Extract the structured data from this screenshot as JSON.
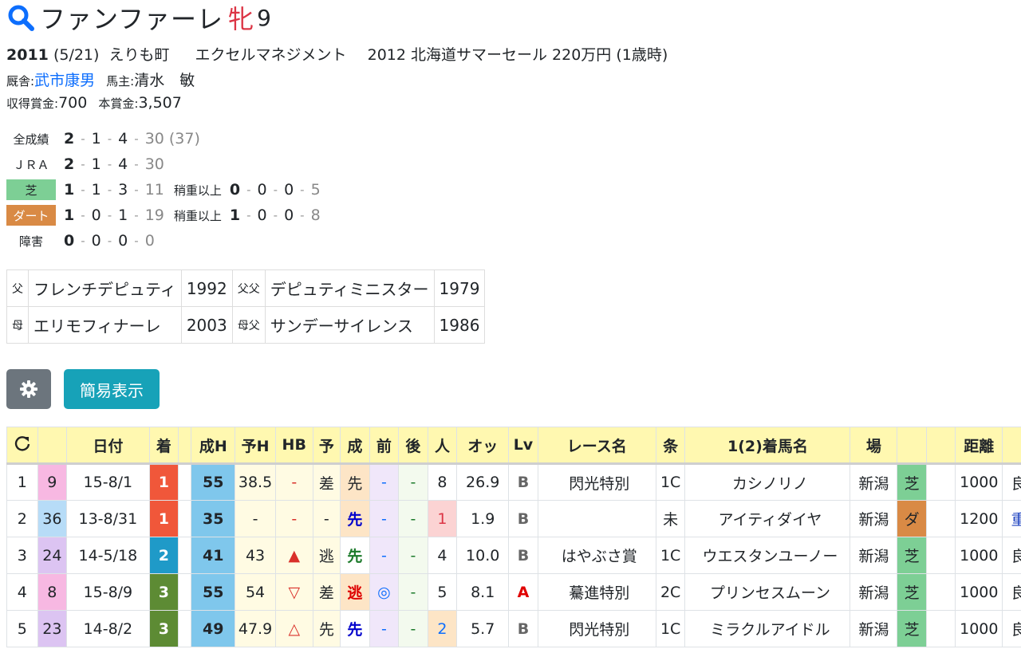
{
  "horse": {
    "name": "ファンファーレ",
    "sex": "牝",
    "age": "9"
  },
  "profile": {
    "birth_year": "2011",
    "birth_date": "(5/21)",
    "breeder_place": "えりも町",
    "breeder": "エクセルマネジメント",
    "sale": "2012 北海道サマーセール 220万円 (1歳時)",
    "trainer_label": "厩舎:",
    "trainer": "武市康男",
    "owner_label": "馬主:",
    "owner": "清水　敏",
    "earned_label": "収得賞金:",
    "earned": "700",
    "prize_label": "本賞金:",
    "prize": "3,507"
  },
  "record": {
    "all": {
      "label": "全成績",
      "w": "2",
      "s": "1",
      "t": "4",
      "o": "30",
      "extra": "(37)"
    },
    "jra": {
      "label": "ＪＲＡ",
      "w": "2",
      "s": "1",
      "t": "4",
      "o": "30"
    },
    "turf": {
      "label": "芝",
      "w": "1",
      "s": "1",
      "t": "3",
      "o": "11",
      "sub_label": "稍重以上",
      "sw": "0",
      "ss": "0",
      "st": "0",
      "so": "5"
    },
    "dirt": {
      "label": "ダート",
      "w": "1",
      "s": "0",
      "t": "1",
      "o": "19",
      "sub_label": "稍重以上",
      "sw": "1",
      "ss": "0",
      "st": "0",
      "so": "8"
    },
    "jump": {
      "label": "障害",
      "w": "0",
      "s": "0",
      "t": "0",
      "o": "0"
    }
  },
  "pedigree": {
    "sire_label": "父",
    "sire": "フレンチデピュティ",
    "sire_year": "1992",
    "sire_sire_label": "父父",
    "sire_sire": "デピュティミニスター",
    "sire_sire_year": "1979",
    "dam_label": "母",
    "dam": "エリモフィナーレ",
    "dam_year": "2003",
    "dam_sire_label": "母父",
    "dam_sire": "サンデーサイレンス",
    "dam_sire_year": "1986"
  },
  "buttons": {
    "simple_view": "簡易表示"
  },
  "table": {
    "headers": [
      "",
      "",
      "日付",
      "着",
      "",
      "成H",
      "予H",
      "HB",
      "予",
      "成",
      "前",
      "後",
      "人",
      "オッ",
      "Lv",
      "レース名",
      "条",
      "1(2)着馬名",
      "場",
      "",
      "",
      "距離",
      ""
    ],
    "rows": [
      {
        "no": "1",
        "waku": "9",
        "date": "15-8/1",
        "rank": "1",
        "seih": "55",
        "yoh": "38.5",
        "hb": "-",
        "yo": "差",
        "sei": "先",
        "mae": "-",
        "ato": "-",
        "pop": "8",
        "odds": "26.9",
        "lv": "B",
        "race": "閃光特別",
        "cond": "1C",
        "winner": "カシノリノ",
        "track": "新潟",
        "surface": "芝",
        "dist": "1000",
        "going": "良"
      },
      {
        "no": "2",
        "waku": "36",
        "date": "13-8/31",
        "rank": "1",
        "seih": "35",
        "yoh": "-",
        "hb": "-",
        "yo": "-",
        "sei": "先",
        "mae": "-",
        "ato": "-",
        "pop": "1",
        "odds": "1.9",
        "lv": "B",
        "race": "",
        "cond": "未",
        "winner": "アイティダイヤ",
        "track": "新潟",
        "surface": "ダ",
        "dist": "1200",
        "going": "重"
      },
      {
        "no": "3",
        "waku": "24",
        "date": "14-5/18",
        "rank": "2",
        "seih": "41",
        "yoh": "43",
        "hb": "▲",
        "yo": "逃",
        "sei": "先",
        "mae": "-",
        "ato": "-",
        "pop": "4",
        "odds": "10.0",
        "lv": "B",
        "race": "はやぶさ賞",
        "cond": "1C",
        "winner": "ウエスタンユーノー",
        "track": "新潟",
        "surface": "芝",
        "dist": "1000",
        "going": "良"
      },
      {
        "no": "4",
        "waku": "8",
        "date": "15-8/9",
        "rank": "3",
        "seih": "55",
        "yoh": "54",
        "hb": "▽",
        "yo": "差",
        "sei": "逃",
        "mae": "◎",
        "ato": "-",
        "pop": "5",
        "odds": "8.1",
        "lv": "A",
        "race": "驀進特別",
        "cond": "2C",
        "winner": "プリンセスムーン",
        "track": "新潟",
        "surface": "芝",
        "dist": "1000",
        "going": "良"
      },
      {
        "no": "5",
        "waku": "23",
        "date": "14-8/2",
        "rank": "3",
        "seih": "49",
        "yoh": "47.9",
        "hb": "△",
        "yo": "先",
        "sei": "先",
        "mae": "-",
        "ato": "-",
        "pop": "2",
        "odds": "5.7",
        "lv": "B",
        "race": "閃光特別",
        "cond": "1C",
        "winner": "ミラクルアイドル",
        "track": "新潟",
        "surface": "芝",
        "dist": "1000",
        "going": "良"
      }
    ]
  },
  "colors": {
    "accent": "#17a2b8",
    "gear_button": "#6c757d",
    "sex_color": "#dc3545",
    "link": "#0d6efd"
  }
}
